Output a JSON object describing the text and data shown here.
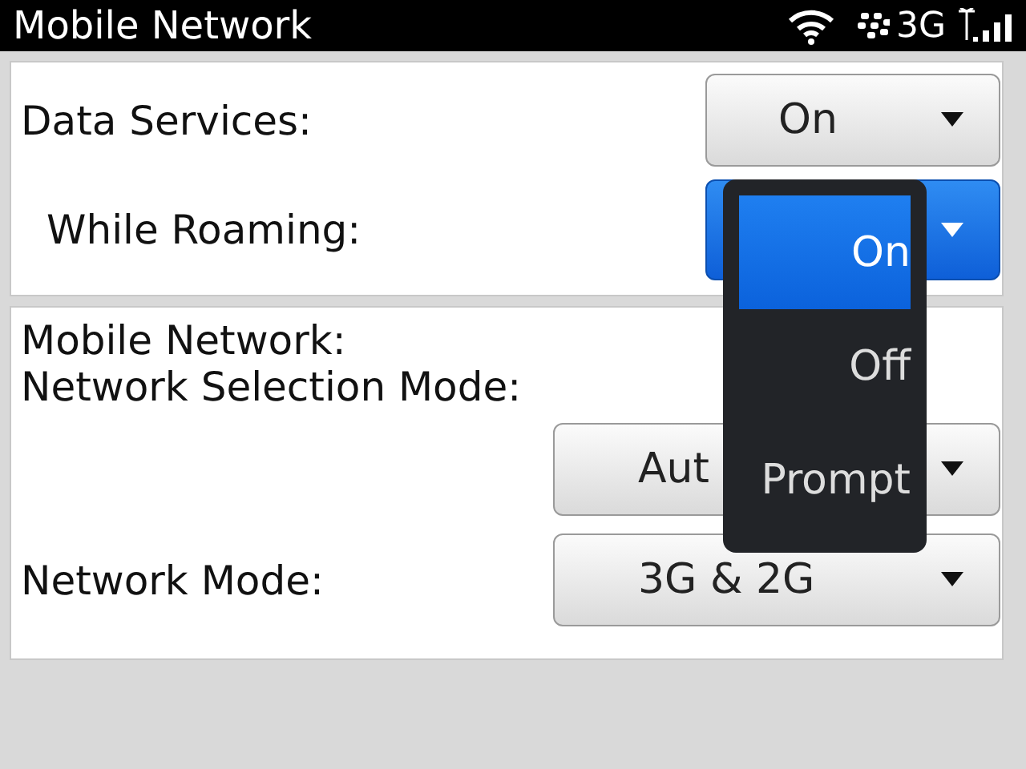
{
  "status_bar": {
    "title": "Mobile Network",
    "network": "3G"
  },
  "data_section": {
    "label": "Data Services:",
    "dropdown": {
      "value": "On",
      "focused": false
    },
    "children": [
      {
        "label": "While Roaming:",
        "dropdown": {
          "focused": true
        }
      }
    ]
  },
  "network_section": {
    "mobile_network_label": "Mobile Network:",
    "selection_label": "Network Selection Mode:",
    "selection_dropdown": {
      "value": "Aut",
      "focused": false
    },
    "mode_label": "Network Mode:",
    "mode_dropdown": {
      "value": "3G & 2G",
      "focused": false
    }
  },
  "popup": {
    "options": [
      {
        "label": "On",
        "selected": true
      },
      {
        "label": "Off",
        "selected": false
      },
      {
        "label": "Prompt",
        "selected": false
      }
    ]
  }
}
